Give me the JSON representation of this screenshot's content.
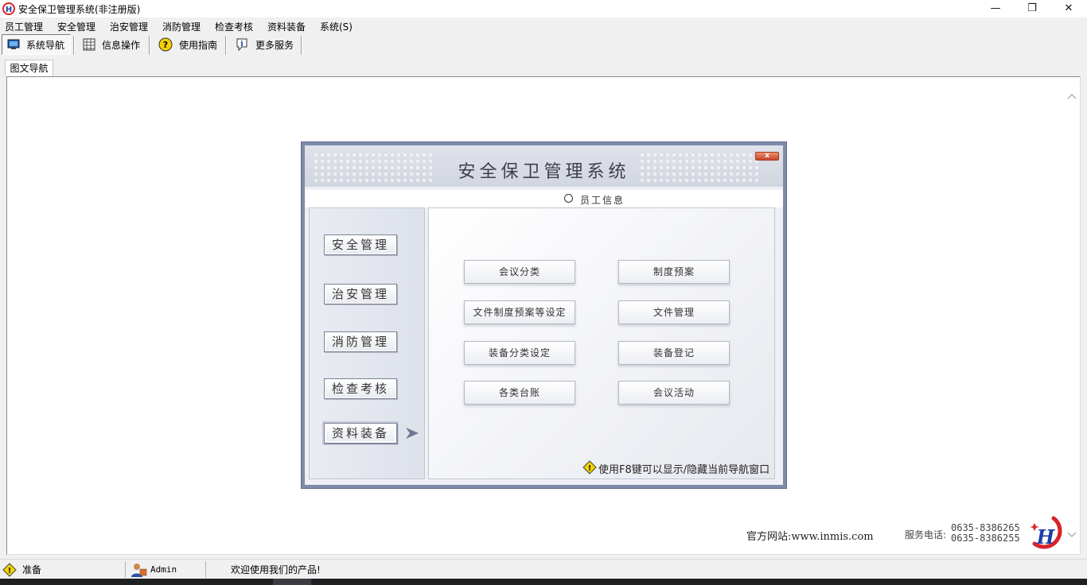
{
  "window": {
    "title": "安全保卫管理系统(非注册版)",
    "minimize": "—",
    "restore": "❐",
    "close": "✕"
  },
  "menu": [
    "员工管理",
    "安全管理",
    "治安管理",
    "消防管理",
    "检查考核",
    "资料装备",
    "系统(S)"
  ],
  "toolbar": [
    {
      "label": "系统导航",
      "icon": "monitor-icon",
      "active": true
    },
    {
      "label": "信息操作",
      "icon": "grid-icon"
    },
    {
      "label": "使用指南",
      "icon": "help-icon"
    },
    {
      "label": "更多服务",
      "icon": "info-icon"
    }
  ],
  "tab": {
    "label": "图文导航"
  },
  "nav": {
    "title": "安全保卫管理系统",
    "close_label": "x",
    "section": "员工信息",
    "categories": [
      "安全管理",
      "治安管理",
      "消防管理",
      "检查考核",
      "资料装备"
    ],
    "active_category": "资料装备",
    "actions": [
      "会议分类",
      "制度预案",
      "文件制度预案等设定",
      "文件管理",
      "装备分类设定",
      "装备登记",
      "各类台账",
      "会议活动"
    ],
    "hint": "使用F8键可以显示/隐藏当前导航窗口"
  },
  "footer": {
    "site": "官方网站:www.inmis.com",
    "phone_label": "服务电话:",
    "phones": [
      "0635-8386265",
      "0635-8386255"
    ]
  },
  "status": {
    "state": "准备",
    "user": "Admin",
    "message": "欢迎使用我们的产品!"
  }
}
